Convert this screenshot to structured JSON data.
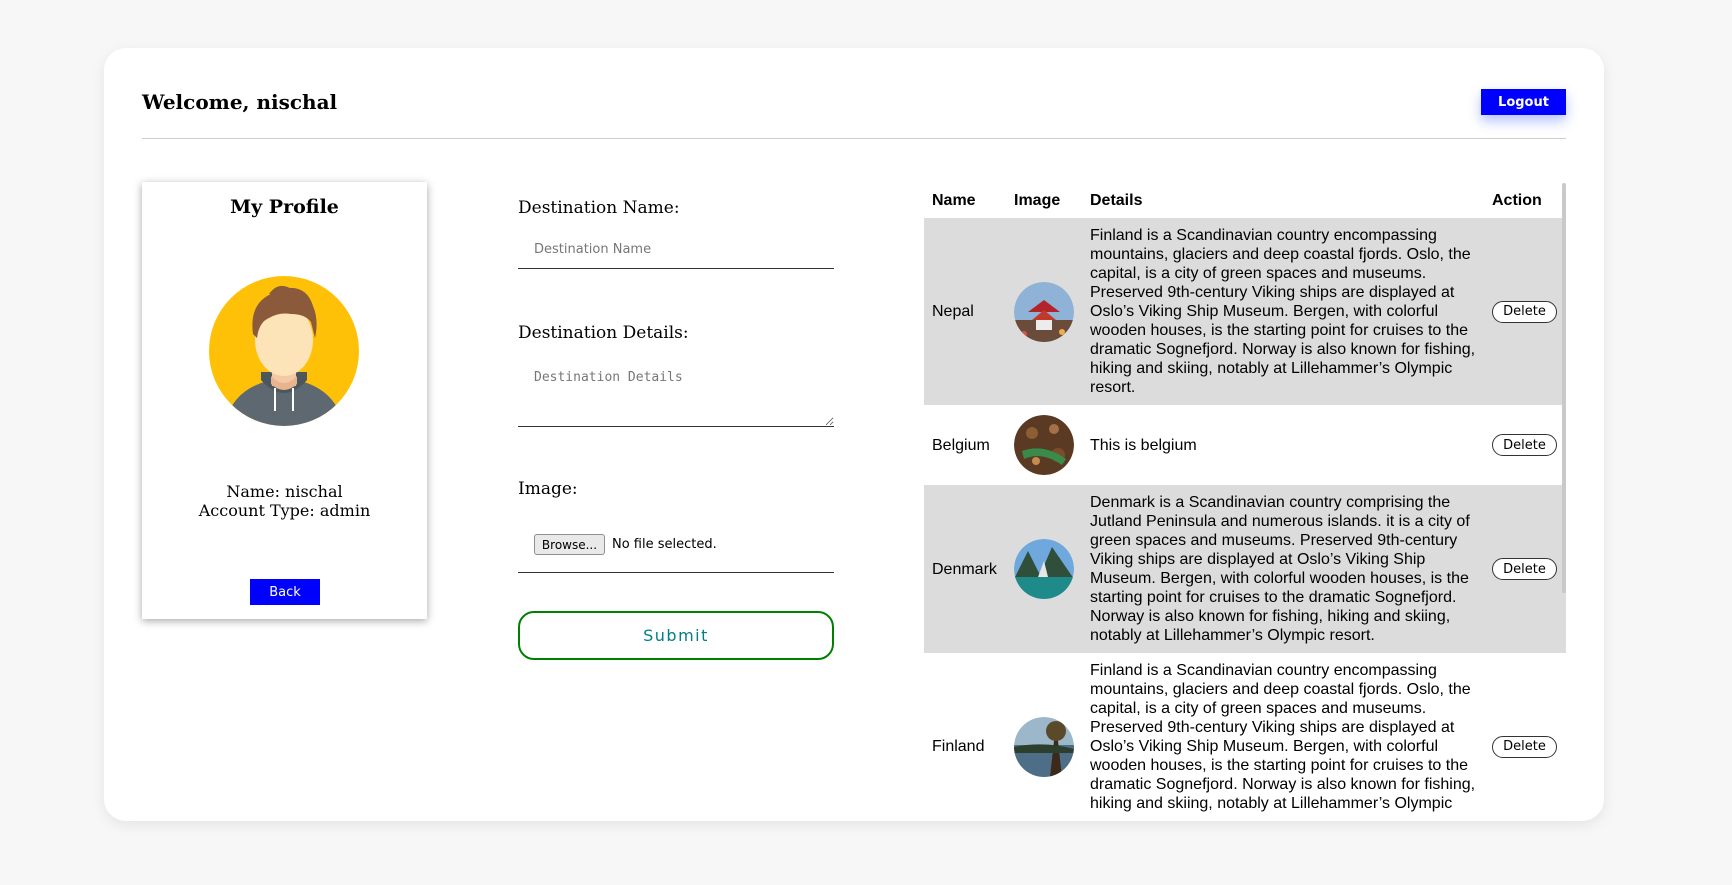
{
  "header": {
    "welcome": "Welcome, nischal",
    "logout_label": "Logout"
  },
  "profile": {
    "title": "My Profile",
    "name_line": "Name: nischal",
    "account_line": "Account Type: admin",
    "back_label": "Back",
    "avatar_icon": "user-avatar-icon",
    "colors": {
      "avatar_bg": "#FFC107",
      "button": "#0000FF"
    }
  },
  "form": {
    "name_label": "Destination Name:",
    "name_placeholder": "Destination Name",
    "details_label": "Destination Details:",
    "details_placeholder": "Destination Details",
    "image_label": "Image:",
    "browse_label": "Browse...",
    "no_file_text": "No file selected.",
    "submit_label": "Submit"
  },
  "table": {
    "headers": [
      "Name",
      "Image",
      "Details",
      "Action"
    ],
    "rows": [
      {
        "name": "Nepal",
        "image_icon": "pagoda-photo",
        "details": "Finland is a Scandinavian country encompassing mountains, glaciers and deep coastal fjords. Oslo, the capital, is a city of green spaces and museums. Preserved 9th-century Viking ships are displayed at Oslo’s Viking Ship Museum. Bergen, with colorful wooden houses, is the starting point for cruises to the dramatic Sognefjord. Norway is also known for fishing, hiking and skiing, notably at Lillehammer’s Olympic resort.",
        "action": "Delete"
      },
      {
        "name": "Belgium",
        "image_icon": "food-photo",
        "details": "This is belgium",
        "action": "Delete"
      },
      {
        "name": "Denmark",
        "image_icon": "lake-photo",
        "details": "Denmark is a Scandinavian country comprising the Jutland Peninsula and numerous islands. it is a city of green spaces and museums. Preserved 9th-century Viking ships are displayed at Oslo’s Viking Ship Museum. Bergen, with colorful wooden houses, is the starting point for cruises to the dramatic Sognefjord. Norway is also known for fishing, hiking and skiing, notably at Lillehammer’s Olympic resort.",
        "action": "Delete"
      },
      {
        "name": "Finland",
        "image_icon": "forest-lake-photo",
        "details": "Finland is a Scandinavian country encompassing mountains, glaciers and deep coastal fjords. Oslo, the capital, is a city of green spaces and museums. Preserved 9th-century Viking ships are displayed at Oslo’s Viking Ship Museum. Bergen, with colorful wooden houses, is the starting point for cruises to the dramatic Sognefjord. Norway is also known for fishing, hiking and skiing, notably at Lillehammer’s Olympic resort.",
        "action": "Delete"
      }
    ]
  }
}
